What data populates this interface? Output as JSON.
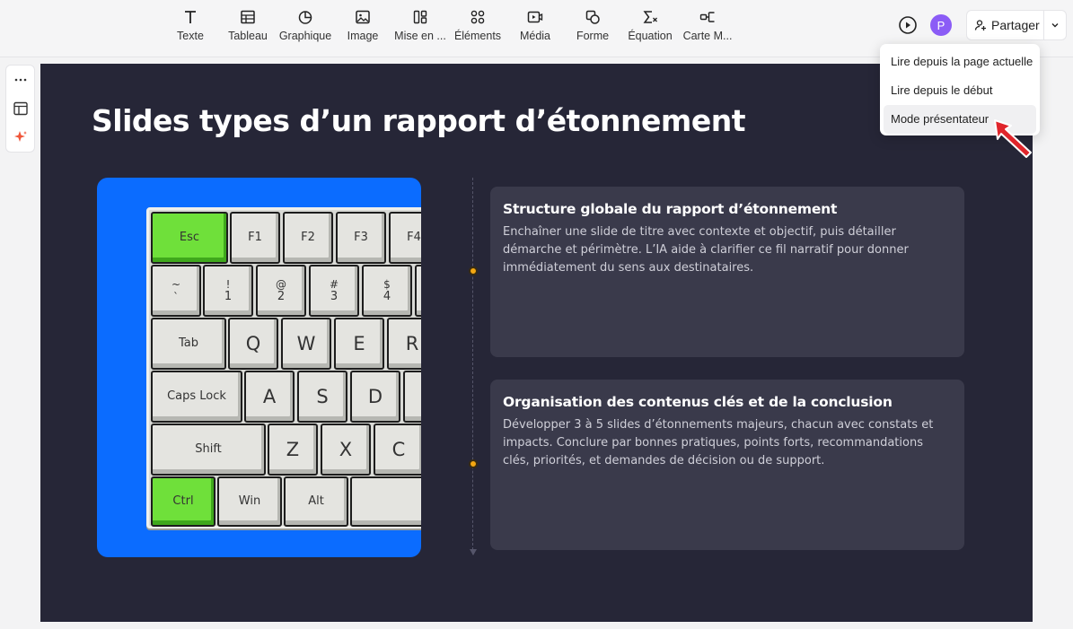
{
  "toolbar": {
    "tools": [
      {
        "label": "Texte",
        "icon": "text-icon"
      },
      {
        "label": "Tableau",
        "icon": "table-icon"
      },
      {
        "label": "Graphique",
        "icon": "chart-icon"
      },
      {
        "label": "Image",
        "icon": "image-icon"
      },
      {
        "label": "Mise en ...",
        "icon": "layout-icon"
      },
      {
        "label": "Éléments",
        "icon": "elements-icon"
      },
      {
        "label": "Média",
        "icon": "media-icon"
      },
      {
        "label": "Forme",
        "icon": "shape-icon"
      },
      {
        "label": "Équation",
        "icon": "equation-icon"
      },
      {
        "label": "Carte M...",
        "icon": "mindmap-icon"
      }
    ],
    "avatar_initial": "P",
    "share_label": "Partager"
  },
  "menu": {
    "items": [
      "Lire depuis la page actuelle",
      "Lire depuis le début",
      "Mode présentateur"
    ]
  },
  "slide": {
    "title": "Slides types d’un rapport d’étonnement",
    "cards": [
      {
        "title": "Structure globale du rapport d’étonnement",
        "body": "Enchaîner une slide de titre avec contexte et objectif, puis détailler démarche et périmètre. L’IA aide à clarifier ce fil narratif pour donner immédiatement du sens aux destinataires."
      },
      {
        "title": "Organisation des contenus clés et de la conclusion",
        "body": "Développer 3 à 5 slides d’étonnements majeurs, chacun avec constats et impacts. Conclure par bonnes pratiques, points forts, recommandations clés, priorités, et demandes de décision ou de support."
      }
    ],
    "keyboard": {
      "row1": [
        "Esc",
        "F1",
        "F2",
        "F3",
        "F4"
      ],
      "row2": [
        [
          "~",
          "`"
        ],
        [
          "!",
          "1"
        ],
        [
          "@",
          "2"
        ],
        [
          "#",
          "3"
        ],
        [
          "$",
          "4"
        ]
      ],
      "row3": [
        "Tab",
        "Q",
        "W",
        "E",
        "R"
      ],
      "row4": [
        "Caps Lock",
        "A",
        "S",
        "D"
      ],
      "row5": [
        "Shift",
        "Z",
        "X",
        "C"
      ],
      "row6": [
        "Ctrl",
        "Win",
        "Alt"
      ]
    }
  },
  "colors": {
    "slide_bg": "#262637",
    "card_bg": "#3a3a4b",
    "accent_blue": "#0b6cff",
    "timeline_dot": "#f3a712",
    "avatar": "#8b5cf6",
    "pointer": "#e0252b"
  }
}
